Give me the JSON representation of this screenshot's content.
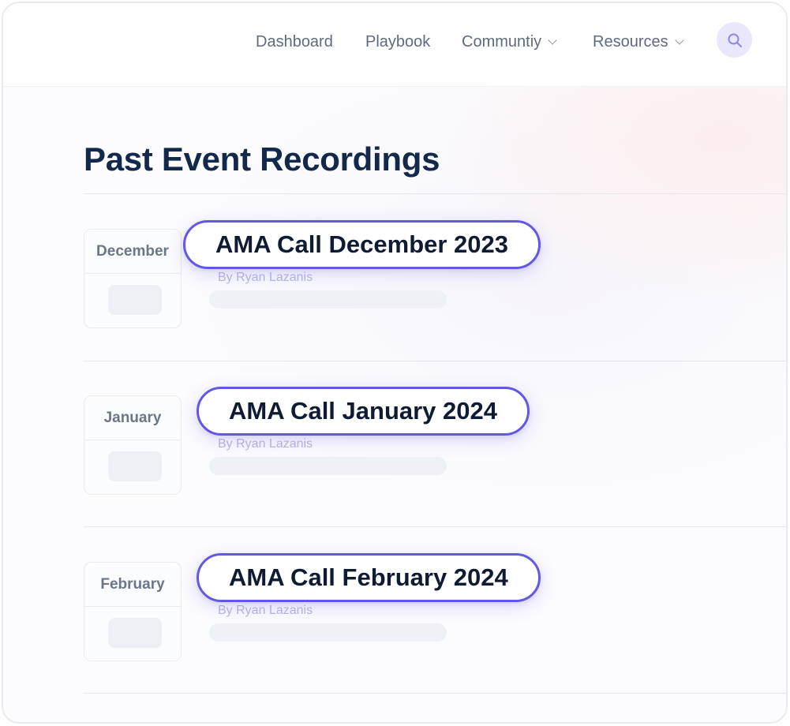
{
  "nav": {
    "items": [
      {
        "label": "Dashboard",
        "has_dropdown": false
      },
      {
        "label": "Playbook",
        "has_dropdown": false
      },
      {
        "label": "Communtiy",
        "has_dropdown": true
      },
      {
        "label": "Resources",
        "has_dropdown": true
      }
    ],
    "search_icon": "search-icon"
  },
  "page": {
    "title": "Past Event Recordings"
  },
  "events": [
    {
      "month": "December",
      "title": "AMA Call December 2023",
      "author": "By Ryan Lazanis"
    },
    {
      "month": "January",
      "title": "AMA Call January 2024",
      "author": "By Ryan Lazanis"
    },
    {
      "month": "February",
      "title": "AMA Call February 2024",
      "author": "By Ryan Lazanis"
    }
  ],
  "colors": {
    "accent": "#6257e6",
    "title": "#13294b",
    "nav_text": "#5d6b80",
    "author_text": "#b3b8e9",
    "search_bg": "#e8e7fb"
  }
}
